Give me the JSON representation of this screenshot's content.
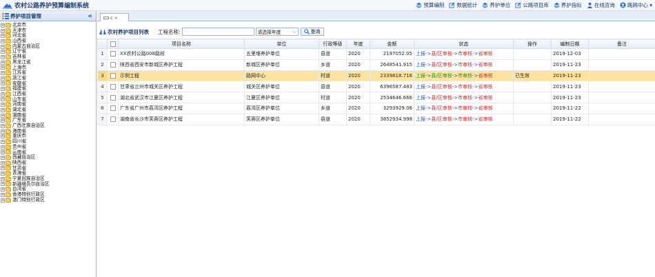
{
  "app": {
    "title": "农村公路养护预算编制系统"
  },
  "topnav": [
    {
      "label": "预算编制",
      "icon": "layers-icon"
    },
    {
      "label": "数据统计",
      "icon": "edit-icon"
    },
    {
      "label": "养护单位",
      "icon": "layers-icon"
    },
    {
      "label": "公路项目库",
      "icon": "edit-icon"
    },
    {
      "label": "养护指标",
      "icon": "layers-icon"
    },
    {
      "label": "在线咨询",
      "icon": "user-icon"
    },
    {
      "label": "路网中心 ▾",
      "icon": "user-circle-icon"
    }
  ],
  "left": {
    "title": "养护项目管理",
    "collapse": "«",
    "tree": [
      "北京市",
      "天津市",
      "河北省",
      "山西省",
      "内蒙古自治区",
      "辽宁省",
      "吉林省",
      "黑龙江省",
      "上海市",
      "江苏省",
      "浙江省",
      "安徽省",
      "福建省",
      "江西省",
      "山东省",
      "河南省",
      "湖北省",
      "湖南省",
      "广东省",
      "广西壮族自治区",
      "海南省",
      "重庆市",
      "四川省",
      "贵州省",
      "云南省",
      "西藏自治区",
      "陕西省",
      "甘肃省",
      "青海省",
      "宁夏回族自治区",
      "新疆维吾尔自治区",
      "台湾省",
      "香港特别行政区",
      "澳门特别行政区"
    ]
  },
  "tab": {
    "label": "c",
    "close": "×"
  },
  "toolbar": {
    "title": "农村养护项目列表",
    "name_label": "工程名称:",
    "name_value": "",
    "year_select": "请选择年度",
    "query_label": "查询"
  },
  "grid": {
    "headers": [
      "",
      "",
      "项目名称",
      "单位",
      "行政等级",
      "年度",
      "金额",
      "状态",
      "操作",
      "编制日期",
      "备注"
    ],
    "rows": [
      {
        "no": "1",
        "name": "XX农村公路008路段",
        "unit": "五里堆养护单位",
        "level": "县道",
        "year": "2020",
        "amount": "2197052.05",
        "op": "",
        "date": "2019-12-03",
        "note": ""
      },
      {
        "no": "2",
        "name": "陕西省西安市新城区养护工程",
        "unit": "新城区养护单位",
        "level": "乡道",
        "year": "2020",
        "amount": "2648541.915",
        "op": "",
        "date": "2019-11-23",
        "note": ""
      },
      {
        "no": "3",
        "name": "示例工程",
        "unit": "路网中心",
        "level": "村道",
        "year": "2020",
        "amount": "2339818.716",
        "op": "已生效",
        "date": "2019-11-23",
        "note": ""
      },
      {
        "no": "4",
        "name": "甘肃省兰州市城关区养护工程",
        "unit": "城关区养护单位",
        "level": "县道",
        "year": "2020",
        "amount": "6396587.483",
        "op": "",
        "date": "2019-11-23",
        "note": ""
      },
      {
        "no": "5",
        "name": "湖北省武汉市江夏区养护工程",
        "unit": "江夏区养护单位",
        "level": "村道",
        "year": "2020",
        "amount": "2534646.666",
        "op": "",
        "date": "2019-11-23",
        "note": ""
      },
      {
        "no": "6",
        "name": "广东省广州市荔湾区养护工程",
        "unit": "荔湾区养护单位",
        "level": "乡道",
        "year": "2020",
        "amount": "3293929.06",
        "op": "",
        "date": "2019-11-22",
        "note": ""
      },
      {
        "no": "7",
        "name": "湖南省长沙市芙蓉区养护工程",
        "unit": "芙蓉区养护单位",
        "level": "县道",
        "year": "2020",
        "amount": "3852934.998",
        "op": "",
        "date": "2019-11-22",
        "note": ""
      }
    ],
    "status_parts": [
      "上报",
      "->",
      "县/区审核",
      "->",
      "市审核",
      "->",
      "省审核"
    ]
  },
  "colors": {
    "accent": "#1a57c8",
    "selected_row": "#fde3a0",
    "status_red": "#d92020",
    "status_green": "#119911"
  }
}
